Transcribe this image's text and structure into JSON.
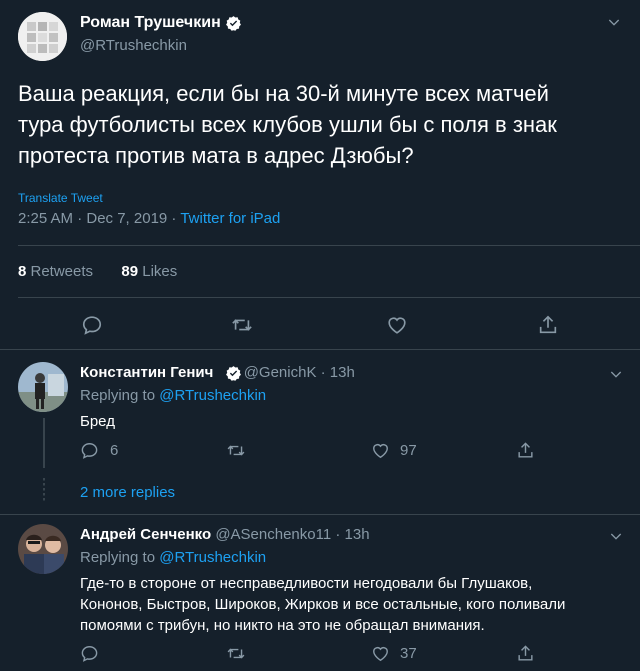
{
  "main_tweet": {
    "author_name": "Роман Трушечкин",
    "handle": "@RTrushechkin",
    "text_lines": [
      "Ваша реакция, если бы на 30-й минуте всех матчей",
      "тура футболисты всех клубов ушли бы с поля в знак",
      "протеста против мата в адрес Дзюбы?"
    ],
    "translate_label": "Translate Tweet",
    "timestamp": "2:25 AM · Dec 7, 2019 · ",
    "source": "Twitter for iPad",
    "retweets_count": "8",
    "retweets_label": " Retweets",
    "likes_count": "89",
    "likes_label": " Likes"
  },
  "replies": [
    {
      "author_name": "Константин Генич",
      "handle": "@GenichK",
      "time": " · 13h",
      "replying_prefix": "Replying to ",
      "replying_to": "@RTrushechkin",
      "text_lines": [
        "Бред"
      ],
      "reply_count": "6",
      "retweet_count": "",
      "like_count": "97",
      "more_replies": "2 more replies"
    },
    {
      "author_name": "Андрей Сенченко",
      "handle": "@ASenchenko11",
      "time": " · 13h",
      "replying_prefix": "Replying to ",
      "replying_to": "@RTrushechkin",
      "text_lines": [
        "Где-то в стороне от несправедливости негодовали бы Глушаков,",
        "Кононов, Быстров, Широков, Жирков и все остальные, кого поливали",
        "помоями с трибун, но никто на это не обращал внимания."
      ],
      "reply_count": "",
      "retweet_count": "",
      "like_count": "37"
    }
  ],
  "colors": {
    "background": "#15202b",
    "muted": "#8899a6",
    "accent": "#1da1f2",
    "divider": "#38444d"
  },
  "icons": [
    "reply-icon",
    "retweet-icon",
    "like-icon",
    "share-icon",
    "verified-icon",
    "chevron-down-icon"
  ]
}
